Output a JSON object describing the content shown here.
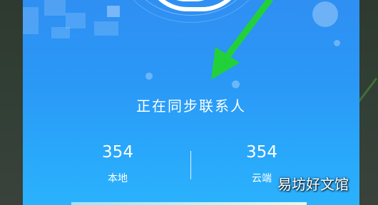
{
  "sync_screen": {
    "title": "正在同步联系人",
    "local": {
      "count": "354",
      "label": "本地"
    },
    "cloud": {
      "count": "354",
      "label": "云端"
    }
  },
  "watermark": "易坊好文馆",
  "colors": {
    "background_top": "#2f8ff2",
    "background_bottom": "#2bb2fc",
    "arrow": "#22d13a",
    "text": "#ffffff"
  },
  "icons": {
    "sync_ring": "sync-ring-icon",
    "arrow": "green-arrow-annotation"
  }
}
